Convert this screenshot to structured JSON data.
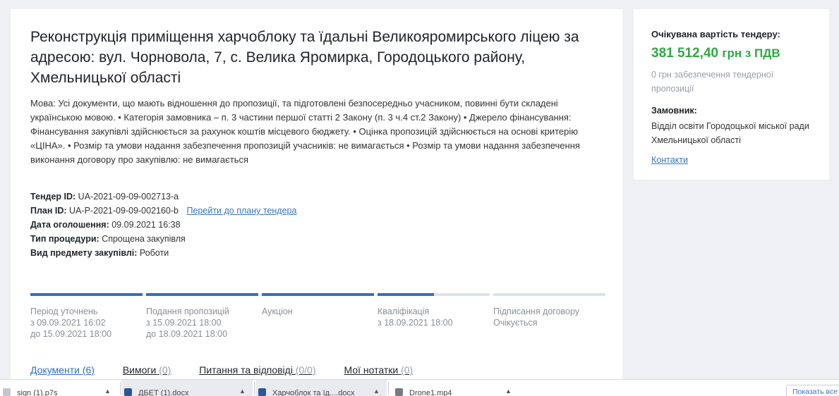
{
  "tender": {
    "title": "Реконструкція приміщення харчоблоку та їдальні Великояромирського ліцею за адресою: вул. Чорновола, 7, с. Велика Яромирка, Городоцького району, Хмельницької області",
    "description": "Мова: Усі документи, що мають відношення до пропозиції, та підготовлені безпосередньо учасником, повинні бути складені українською мовою. • Категорія замовника – п. 3 частини першої статті 2 Закону (п. 3 ч.4 ст.2 Закону) • Джерело фінансування: Фінансування закупівлі здійснюється за рахунок коштів місцевого бюджету. • Оцінка пропозицій здійснюється на основі критерію «ЦІНА». • Розмір та умови надання забезпечення пропозицій учасників: не вимагається • Розмір та умови надання забезпечення виконання договору про закупівлю: не вимагається",
    "info": {
      "tender_id_label": "Тендер ID:",
      "tender_id": "UA-2021-09-09-002713-a",
      "plan_id_label": "План ID:",
      "plan_id": "UA-P-2021-09-09-002160-b",
      "plan_link": "Перейти до плану тендера",
      "date_label": "Дата оголошення:",
      "date": "09.09.2021 16:38",
      "procedure_label": "Тип процедури:",
      "procedure": "Спрощена закупівля",
      "subject_label": "Вид предмету закупівлі:",
      "subject": "Роботи"
    }
  },
  "stages": [
    {
      "name": "Період уточнень",
      "line1": "з 09.09.2021 16:02",
      "line2": "до 15.09.2021 18:00",
      "progress": 1.0
    },
    {
      "name": "Подання пропозицій",
      "line1": "з 15.09.2021 18:00",
      "line2": "до 18.09.2021 18:00",
      "progress": 1.0
    },
    {
      "name": "Аукціон",
      "line1": "",
      "line2": "",
      "progress": 1.0
    },
    {
      "name": "Кваліфікація",
      "line1": "з 18.09.2021 18:00",
      "line2": "",
      "progress": 0.5
    },
    {
      "name": "Підписання договору",
      "line1": "Очікується",
      "line2": "",
      "progress": 0.0
    }
  ],
  "tabs": [
    {
      "label": "Документи",
      "count": "(6)",
      "active": true
    },
    {
      "label": "Вимоги",
      "count": "(0)",
      "active": false
    },
    {
      "label": "Питання та відповіді",
      "count": "(0/0)",
      "active": false
    },
    {
      "label": "Мої нотатки",
      "count": "(0)",
      "active": false
    }
  ],
  "side": {
    "price_label": "Очікувана вартість тендеру:",
    "price_value": "381 512,40",
    "price_unit": "грн з ПДВ",
    "guarantee": "0 грн забезпечення тендерної пропозиції",
    "customer_label": "Замовник:",
    "customer_name": "Відділ освіти Городоцької міської ради Хмельницької області",
    "contacts": "Контакти"
  },
  "downloads": {
    "items": [
      {
        "name": "sign (1).p7s",
        "icon": "file-icon",
        "active": false
      },
      {
        "name": "ДБЕТ (1).docx",
        "icon": "word-doc-icon",
        "active": true
      },
      {
        "name": "Харчоблок та їд....docx",
        "icon": "word-doc-icon",
        "active": true
      },
      {
        "name": "Drone1.mp4",
        "icon": "video-file-icon",
        "active": false
      }
    ],
    "show_all": "Показать все"
  },
  "colors": {
    "accent": "#2d6fcc",
    "price_green": "#2fa845",
    "link": "#3a75c4"
  }
}
